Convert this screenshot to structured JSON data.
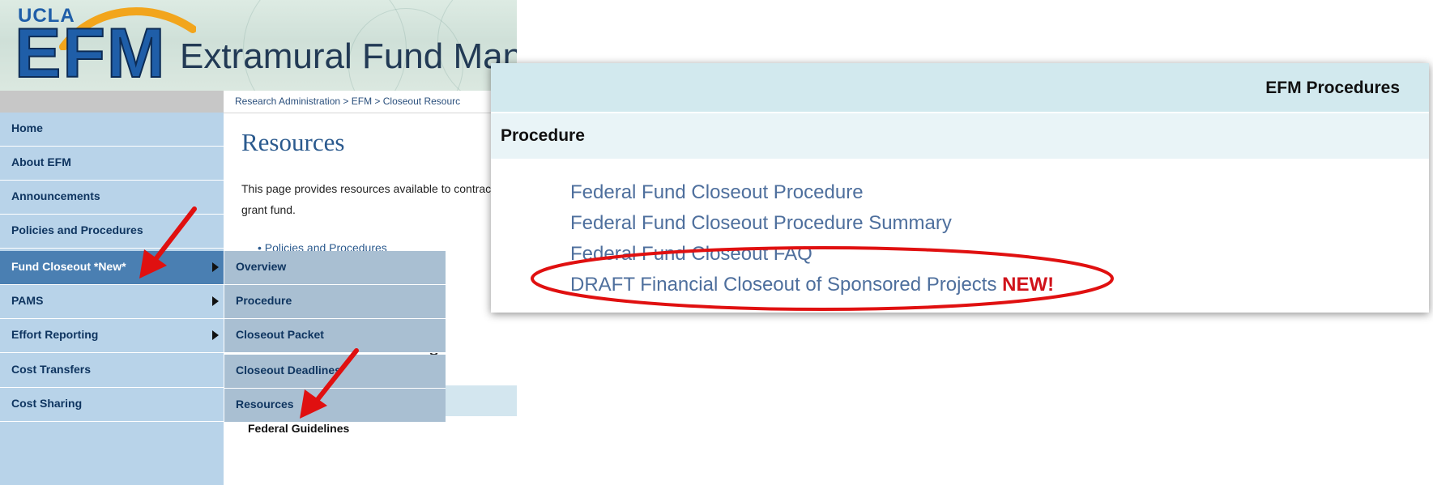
{
  "left_screenshot": {
    "logo": {
      "institution": "UCLA",
      "acronym": "EFM",
      "title": "Extramural Fund Management"
    },
    "breadcrumb": "Research Administration > EFM > Closeout Resourc",
    "sidebar": {
      "items": [
        {
          "label": "Home",
          "has_submenu": false
        },
        {
          "label": "About EFM",
          "has_submenu": false
        },
        {
          "label": "Announcements",
          "has_submenu": false
        },
        {
          "label": "Policies and Procedures",
          "has_submenu": false
        },
        {
          "label": "Fund Closeout *New*",
          "has_submenu": true,
          "active": true
        },
        {
          "label": "PAMS",
          "has_submenu": true
        },
        {
          "label": "Effort Reporting",
          "has_submenu": true
        },
        {
          "label": "Cost Transfers",
          "has_submenu": false
        },
        {
          "label": "Cost Sharing",
          "has_submenu": false
        }
      ]
    },
    "submenu": {
      "items": [
        "Overview",
        "Procedure",
        "Closeout Packet",
        "Closeout Deadlines",
        "Resources"
      ]
    },
    "content": {
      "title": "Resources",
      "intro": "This page provides resources available to contract and grant fund.",
      "bullet": "Policies and Procedures",
      "heading_fragment": "s",
      "federal_guidelines": "Federal Guidelines"
    }
  },
  "zoom_panel": {
    "header_title": "EFM Procedures",
    "section_heading": "Procedure",
    "links": [
      {
        "label": "Federal Fund Closeout Procedure"
      },
      {
        "label": "Federal Fund Closeout Procedure Summary"
      },
      {
        "label": "Federal Fund Closeout FAQ"
      },
      {
        "label": "DRAFT Financial Closeout of Sponsored Projects",
        "badge": "NEW!"
      }
    ]
  },
  "colors": {
    "sidebar_bg": "#b8d3e9",
    "sidebar_active": "#4a7fb2",
    "submenu_bg": "#a9bfd2",
    "link_color": "#4e6f9d",
    "annotation_red": "#e01010",
    "new_badge": "#d0121a"
  }
}
